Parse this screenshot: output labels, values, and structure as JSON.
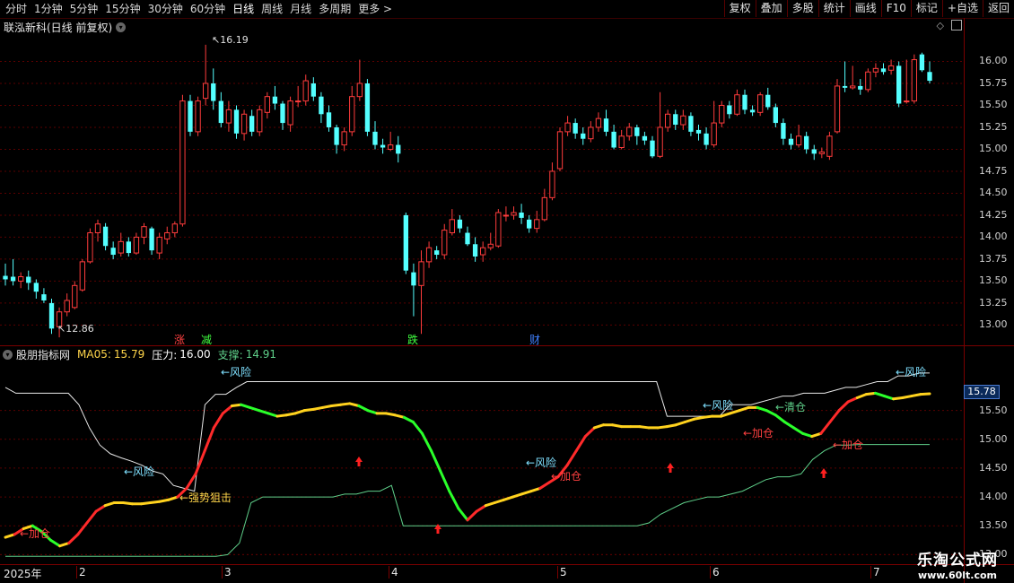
{
  "toolbar": {
    "periods": [
      "分时",
      "1分钟",
      "5分钟",
      "15分钟",
      "30分钟",
      "60分钟",
      "日线",
      "周线",
      "月线",
      "多周期",
      "更多 >"
    ],
    "active_period": "日线",
    "right_buttons": [
      "复权",
      "叠加",
      "多股",
      "统计",
      "画线",
      "F10",
      "标记",
      "+自选",
      "返回"
    ]
  },
  "stock": {
    "title": "联泓新科(日线 前复权)"
  },
  "price_axis": [
    "16.00",
    "15.75",
    "15.50",
    "15.25",
    "15.00",
    "14.75",
    "14.50",
    "14.25",
    "14.00",
    "13.75",
    "13.50",
    "13.25",
    "13.00"
  ],
  "markers": {
    "high": "16.19",
    "low": "12.86"
  },
  "events": [
    {
      "text": "涨",
      "color": "#ff4040"
    },
    {
      "text": "减",
      "color": "#40ff40"
    },
    {
      "text": "跌",
      "color": "#40ff40"
    },
    {
      "text": "财",
      "color": "#4080ff"
    }
  ],
  "indicator": {
    "name": "股朋指标网",
    "ma_label": "MA05:",
    "ma_value": "15.79",
    "pressure_label": "压力:",
    "pressure_value": "16.00",
    "support_label": "支撑:",
    "support_value": "14.91",
    "current_value": "15.78",
    "axis": [
      "15.50",
      "15.00",
      "14.50",
      "14.00",
      "13.50",
      "13.00"
    ],
    "annotations": {
      "risk": "←风险",
      "add": "←加仓",
      "clear": "←清仓",
      "strong": "←强势狙击"
    }
  },
  "date_axis": {
    "year_label": "2025年",
    "months": [
      "2",
      "3",
      "4",
      "5",
      "6",
      "7"
    ]
  },
  "watermark": {
    "line1": "乐淘公式网",
    "line2": "www.60lt.com"
  },
  "colors": {
    "up": "#ff3c3c",
    "down": "#54ffff",
    "grid": "#7a0000",
    "line_white": "#e8e8e8",
    "support": "#5fd08a"
  },
  "chart_data": {
    "type": "candlestick",
    "ylim": [
      12.8,
      16.25
    ],
    "candles": [
      [
        13.56,
        13.52,
        13.7,
        13.45
      ],
      [
        13.55,
        13.5,
        13.75,
        13.45
      ],
      [
        13.5,
        13.55,
        13.6,
        13.42
      ],
      [
        13.55,
        13.48,
        13.62,
        13.4
      ],
      [
        13.48,
        13.38,
        13.52,
        13.3
      ],
      [
        13.35,
        13.28,
        13.42,
        13.25
      ],
      [
        13.25,
        12.96,
        13.3,
        12.9
      ],
      [
        12.98,
        13.15,
        13.2,
        12.86
      ],
      [
        13.15,
        13.28,
        13.36,
        13.1
      ],
      [
        13.2,
        13.45,
        13.5,
        13.18
      ],
      [
        13.4,
        13.72,
        13.75,
        13.38
      ],
      [
        13.72,
        14.05,
        14.1,
        13.7
      ],
      [
        14.05,
        14.15,
        14.2,
        13.95
      ],
      [
        14.12,
        13.9,
        14.16,
        13.85
      ],
      [
        13.88,
        13.8,
        13.95,
        13.75
      ],
      [
        13.82,
        13.95,
        14.05,
        13.78
      ],
      [
        13.95,
        13.82,
        14.0,
        13.78
      ],
      [
        13.82,
        14.0,
        14.05,
        13.8
      ],
      [
        14.0,
        14.12,
        14.16,
        13.92
      ],
      [
        14.1,
        13.85,
        14.12,
        13.8
      ],
      [
        13.82,
        14.0,
        14.05,
        13.75
      ],
      [
        13.98,
        14.05,
        14.12,
        13.92
      ],
      [
        14.05,
        14.15,
        14.18,
        14.0
      ],
      [
        14.15,
        15.55,
        15.62,
        14.12
      ],
      [
        15.55,
        15.2,
        15.62,
        15.15
      ],
      [
        15.2,
        15.55,
        15.6,
        15.15
      ],
      [
        15.58,
        15.75,
        16.19,
        15.5
      ],
      [
        15.75,
        15.55,
        15.92,
        15.45
      ],
      [
        15.55,
        15.3,
        15.65,
        15.25
      ],
      [
        15.3,
        15.45,
        15.55,
        15.2
      ],
      [
        15.45,
        15.18,
        15.5,
        15.12
      ],
      [
        15.18,
        15.4,
        15.45,
        15.1
      ],
      [
        15.38,
        15.2,
        15.45,
        15.15
      ],
      [
        15.2,
        15.45,
        15.5,
        15.15
      ],
      [
        15.42,
        15.6,
        15.65,
        15.35
      ],
      [
        15.6,
        15.52,
        15.72,
        15.45
      ],
      [
        15.52,
        15.3,
        15.55,
        15.22
      ],
      [
        15.28,
        15.55,
        15.6,
        15.2
      ],
      [
        15.55,
        15.55,
        15.72,
        15.48
      ],
      [
        15.55,
        15.78,
        15.85,
        15.5
      ],
      [
        15.75,
        15.6,
        15.82,
        15.55
      ],
      [
        15.6,
        15.4,
        15.65,
        15.3
      ],
      [
        15.42,
        15.25,
        15.5,
        15.2
      ],
      [
        15.25,
        15.05,
        15.28,
        14.95
      ],
      [
        15.05,
        15.2,
        15.25,
        14.98
      ],
      [
        15.2,
        15.6,
        15.72,
        15.15
      ],
      [
        15.6,
        15.75,
        16.02,
        15.55
      ],
      [
        15.75,
        15.2,
        15.8,
        15.15
      ],
      [
        15.2,
        15.05,
        15.32,
        15.0
      ],
      [
        15.05,
        15.02,
        15.12,
        14.95
      ],
      [
        15.0,
        15.05,
        15.2,
        14.98
      ],
      [
        15.05,
        14.95,
        15.15,
        14.85
      ],
      [
        14.25,
        13.62,
        14.28,
        13.58
      ],
      [
        13.6,
        13.45,
        13.7,
        13.1
      ],
      [
        13.45,
        13.72,
        13.85,
        12.9
      ],
      [
        13.72,
        13.88,
        13.95,
        13.65
      ],
      [
        13.85,
        13.8,
        13.9,
        13.75
      ],
      [
        13.8,
        14.08,
        14.15,
        13.75
      ],
      [
        14.05,
        14.2,
        14.32,
        14.02
      ],
      [
        14.2,
        14.1,
        14.25,
        14.05
      ],
      [
        14.05,
        13.92,
        14.12,
        13.9
      ],
      [
        13.92,
        13.78,
        14.0,
        13.72
      ],
      [
        13.8,
        13.88,
        13.95,
        13.72
      ],
      [
        13.88,
        13.92,
        14.05,
        13.85
      ],
      [
        13.9,
        14.28,
        14.32,
        13.88
      ],
      [
        14.25,
        14.25,
        14.35,
        14.18
      ],
      [
        14.25,
        14.28,
        14.35,
        14.2
      ],
      [
        14.28,
        14.22,
        14.38,
        14.15
      ],
      [
        14.2,
        14.1,
        14.25,
        14.05
      ],
      [
        14.1,
        14.2,
        14.3,
        14.05
      ],
      [
        14.2,
        14.45,
        14.55,
        14.18
      ],
      [
        14.45,
        14.75,
        14.85,
        14.42
      ],
      [
        14.78,
        15.2,
        15.25,
        14.75
      ],
      [
        15.2,
        15.3,
        15.38,
        15.15
      ],
      [
        15.3,
        15.18,
        15.35,
        15.12
      ],
      [
        15.18,
        15.12,
        15.25,
        15.05
      ],
      [
        15.12,
        15.25,
        15.32,
        15.08
      ],
      [
        15.25,
        15.35,
        15.42,
        15.2
      ],
      [
        15.35,
        15.2,
        15.45,
        15.15
      ],
      [
        15.2,
        15.02,
        15.28,
        15.0
      ],
      [
        15.02,
        15.15,
        15.22,
        15.0
      ],
      [
        15.15,
        15.25,
        15.3,
        15.1
      ],
      [
        15.25,
        15.15,
        15.28,
        15.05
      ],
      [
        15.15,
        15.1,
        15.2,
        15.05
      ],
      [
        15.1,
        14.92,
        15.15,
        14.9
      ],
      [
        14.92,
        15.25,
        15.65,
        14.9
      ],
      [
        15.25,
        15.4,
        15.45,
        15.2
      ],
      [
        15.4,
        15.28,
        15.45,
        15.22
      ],
      [
        15.28,
        15.38,
        15.45,
        15.22
      ],
      [
        15.38,
        15.2,
        15.42,
        15.15
      ],
      [
        15.22,
        15.18,
        15.28,
        15.1
      ],
      [
        15.18,
        15.05,
        15.25,
        15.0
      ],
      [
        15.05,
        15.3,
        15.55,
        15.02
      ],
      [
        15.3,
        15.5,
        15.55,
        15.25
      ],
      [
        15.5,
        15.4,
        15.55,
        15.35
      ],
      [
        15.4,
        15.62,
        15.68,
        15.38
      ],
      [
        15.62,
        15.45,
        15.68,
        15.4
      ],
      [
        15.45,
        15.42,
        15.5,
        15.38
      ],
      [
        15.42,
        15.62,
        15.65,
        15.38
      ],
      [
        15.62,
        15.48,
        15.7,
        15.45
      ],
      [
        15.48,
        15.3,
        15.52,
        15.25
      ],
      [
        15.3,
        15.12,
        15.35,
        15.05
      ],
      [
        15.12,
        15.05,
        15.18,
        15.0
      ],
      [
        15.05,
        15.15,
        15.28,
        15.02
      ],
      [
        15.15,
        15.0,
        15.2,
        14.95
      ],
      [
        15.0,
        14.95,
        15.05,
        14.88
      ],
      [
        14.95,
        14.97,
        15.02,
        14.9
      ],
      [
        14.92,
        15.15,
        15.2,
        14.88
      ],
      [
        15.2,
        15.72,
        15.8,
        15.18
      ],
      [
        15.72,
        15.7,
        16.0,
        15.65
      ],
      [
        15.7,
        15.72,
        15.95,
        15.68
      ],
      [
        15.72,
        15.68,
        15.8,
        15.62
      ],
      [
        15.68,
        15.88,
        15.92,
        15.65
      ],
      [
        15.88,
        15.92,
        15.98,
        15.82
      ],
      [
        15.92,
        15.88,
        15.98,
        15.85
      ],
      [
        15.9,
        15.95,
        16.02,
        15.85
      ],
      [
        15.95,
        15.52,
        16.0,
        15.48
      ],
      [
        15.55,
        15.55,
        16.02,
        15.52
      ],
      [
        15.55,
        16.02,
        16.08,
        15.52
      ],
      [
        16.08,
        15.9,
        16.1,
        15.88
      ],
      [
        15.88,
        15.78,
        16.0,
        15.75
      ]
    ],
    "indicator_lines": {
      "ma05": [
        13.3,
        13.35,
        13.45,
        13.5,
        13.4,
        13.25,
        13.15,
        13.2,
        13.35,
        13.55,
        13.75,
        13.85,
        13.9,
        13.9,
        13.88,
        13.88,
        13.9,
        13.92,
        13.95,
        14.0,
        14.15,
        14.4,
        14.8,
        15.2,
        15.45,
        15.58,
        15.6,
        15.55,
        15.5,
        15.45,
        15.4,
        15.42,
        15.45,
        15.5,
        15.52,
        15.55,
        15.58,
        15.6,
        15.62,
        15.58,
        15.5,
        15.45,
        15.45,
        15.42,
        15.38,
        15.3,
        15.1,
        14.8,
        14.45,
        14.1,
        13.8,
        13.6,
        13.75,
        13.85,
        13.9,
        13.95,
        14.0,
        14.05,
        14.1,
        14.15,
        14.25,
        14.35,
        14.55,
        14.8,
        15.05,
        15.2,
        15.25,
        15.25,
        15.22,
        15.22,
        15.22,
        15.2,
        15.2,
        15.22,
        15.25,
        15.3,
        15.35,
        15.38,
        15.4,
        15.4,
        15.45,
        15.5,
        15.55,
        15.55,
        15.5,
        15.42,
        15.3,
        15.2,
        15.1,
        15.05,
        15.1,
        15.3,
        15.5,
        15.65,
        15.72,
        15.78,
        15.8,
        15.75,
        15.7,
        15.72,
        15.75,
        15.78,
        15.79
      ],
      "pressure": [
        15.9,
        15.8,
        15.8,
        15.8,
        15.8,
        15.8,
        15.8,
        15.6,
        15.2,
        14.9,
        14.75,
        14.68,
        14.62,
        14.55,
        14.45,
        14.4,
        14.2,
        14.15,
        14.1,
        15.6,
        15.78,
        15.78,
        15.9,
        16.0,
        16.0,
        16.0,
        16.0,
        16.0,
        16.0,
        16.0,
        16.0,
        16.0,
        16.0,
        16.0,
        16.0,
        16.0,
        16.0,
        16.0,
        16.0,
        16.0,
        16.0,
        16.0,
        16.0,
        16.0,
        16.0,
        16.0,
        16.0,
        16.0,
        16.0,
        16.0,
        16.0,
        16.0,
        16.0,
        16.0,
        16.0,
        16.0,
        16.0,
        16.0,
        16.0,
        16.0,
        16.0,
        16.0,
        16.0,
        15.4,
        15.4,
        15.4,
        15.4,
        15.4,
        15.4,
        15.6,
        15.6,
        15.6,
        15.65,
        15.7,
        15.75,
        15.75,
        15.8,
        15.8,
        15.8,
        15.85,
        15.9,
        15.9,
        15.95,
        16.0,
        16.0,
        16.1,
        16.1,
        16.15,
        16.15
      ],
      "support": [
        12.97,
        12.97,
        12.97,
        12.97,
        12.97,
        12.97,
        12.97,
        12.97,
        12.97,
        12.97,
        12.97,
        12.97,
        12.97,
        12.97,
        12.97,
        12.97,
        12.97,
        12.97,
        12.97,
        13.0,
        13.2,
        13.9,
        14.0,
        14.0,
        14.0,
        14.0,
        14.0,
        14.0,
        14.0,
        14.05,
        14.05,
        14.1,
        14.1,
        14.2,
        13.5,
        13.5,
        13.5,
        13.5,
        13.5,
        13.5,
        13.5,
        13.5,
        13.5,
        13.5,
        13.5,
        13.5,
        13.5,
        13.5,
        13.5,
        13.5,
        13.5,
        13.5,
        13.5,
        13.5,
        13.5,
        13.55,
        13.7,
        13.8,
        13.9,
        13.95,
        14.0,
        14.0,
        14.05,
        14.1,
        14.2,
        14.3,
        14.35,
        14.35,
        14.4,
        14.65,
        14.8,
        14.9,
        14.9,
        14.91,
        14.91,
        14.91,
        14.91,
        14.91,
        14.91,
        14.91
      ]
    }
  }
}
